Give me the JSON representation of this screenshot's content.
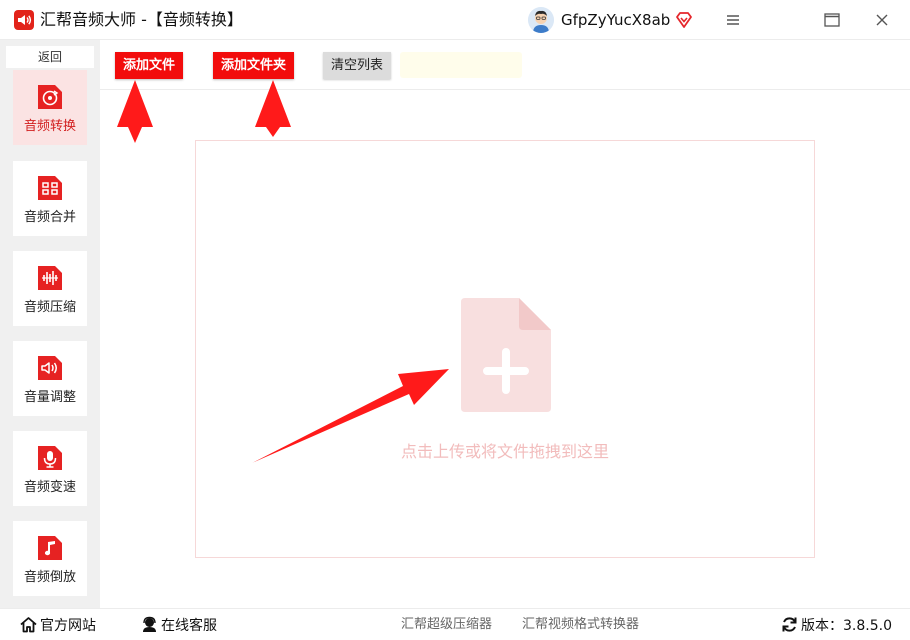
{
  "window": {
    "title": "汇帮音频大师  -【音频转换】",
    "username": "GfpZyYucX8ab"
  },
  "sidebar": {
    "back_label": "返回",
    "items": [
      {
        "label": "音频转换"
      },
      {
        "label": "音频合并"
      },
      {
        "label": "音频压缩"
      },
      {
        "label": "音量调整"
      },
      {
        "label": "音频变速"
      },
      {
        "label": "音频倒放"
      }
    ],
    "active_index": 0
  },
  "toolbar": {
    "add_file_label": "添加文件",
    "add_folder_label": "添加文件夹",
    "clear_list_label": "清空列表"
  },
  "dropzone": {
    "hint": "点击上传或将文件拖拽到这里"
  },
  "statusbar": {
    "official_site": "官方网站",
    "online_service": "在线客服",
    "compressor_link": "汇帮超级压缩器",
    "video_converter_link": "汇帮视频格式转换器",
    "version_label": "版本：",
    "version": "3.8.5.0"
  },
  "colors": {
    "accent": "#f20c0c",
    "active_nav_bg": "#fbe3e3",
    "hint_text": "#f2bcbc",
    "annotation_arrow": "#ff1a1a"
  }
}
